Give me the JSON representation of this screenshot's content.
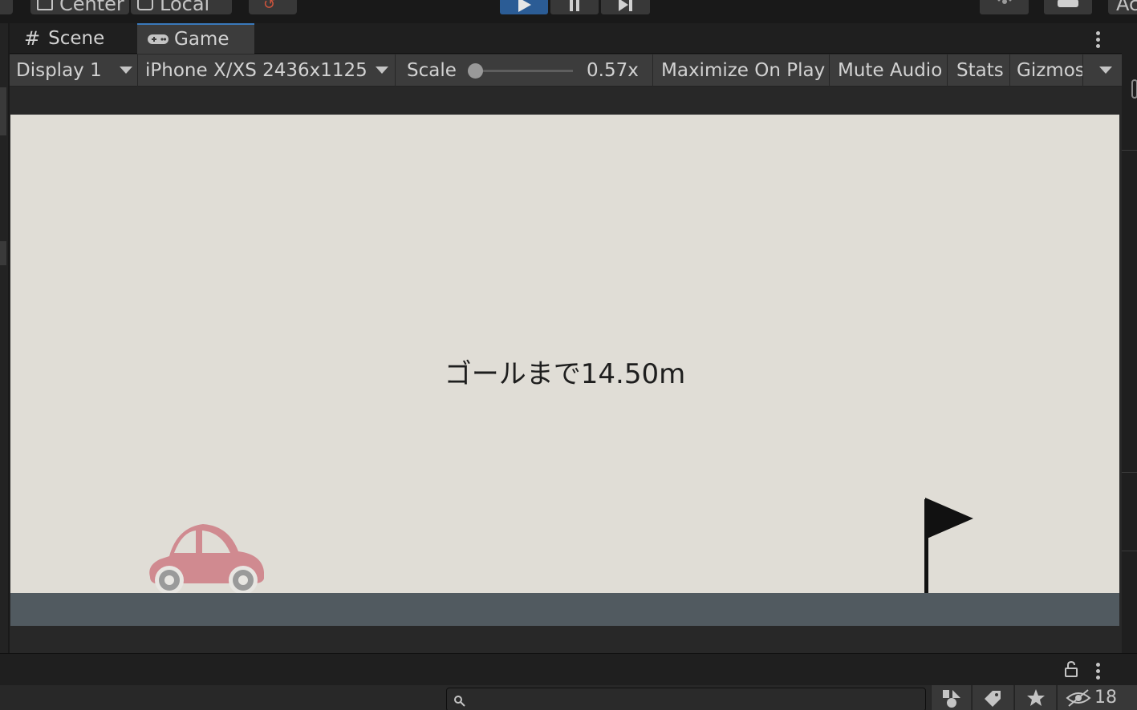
{
  "toolbar": {
    "pivot_label": "Center",
    "space_label": "Local",
    "account_label": "Ac"
  },
  "tabs": [
    {
      "label": "Scene",
      "icon": "hash-icon"
    },
    {
      "label": "Game",
      "icon": "gamepad-icon"
    }
  ],
  "gamebar": {
    "display": "Display 1",
    "resolution": "iPhone X/XS 2436x1125 L",
    "scale_label": "Scale",
    "scale_value": "0.57x",
    "maximize": "Maximize On Play",
    "mute": "Mute Audio",
    "stats": "Stats",
    "gizmos": "Gizmos"
  },
  "game": {
    "goal_text": "ゴールまで14.50m",
    "car_color": "#d08a90",
    "ground_color": "#515a60",
    "background_color": "#e0ddd6",
    "flag_color": "#111111"
  },
  "bottom": {
    "hidden_count": "18"
  },
  "colors": {
    "accent": "#3a79bb",
    "play_active": "#2b5c95"
  }
}
